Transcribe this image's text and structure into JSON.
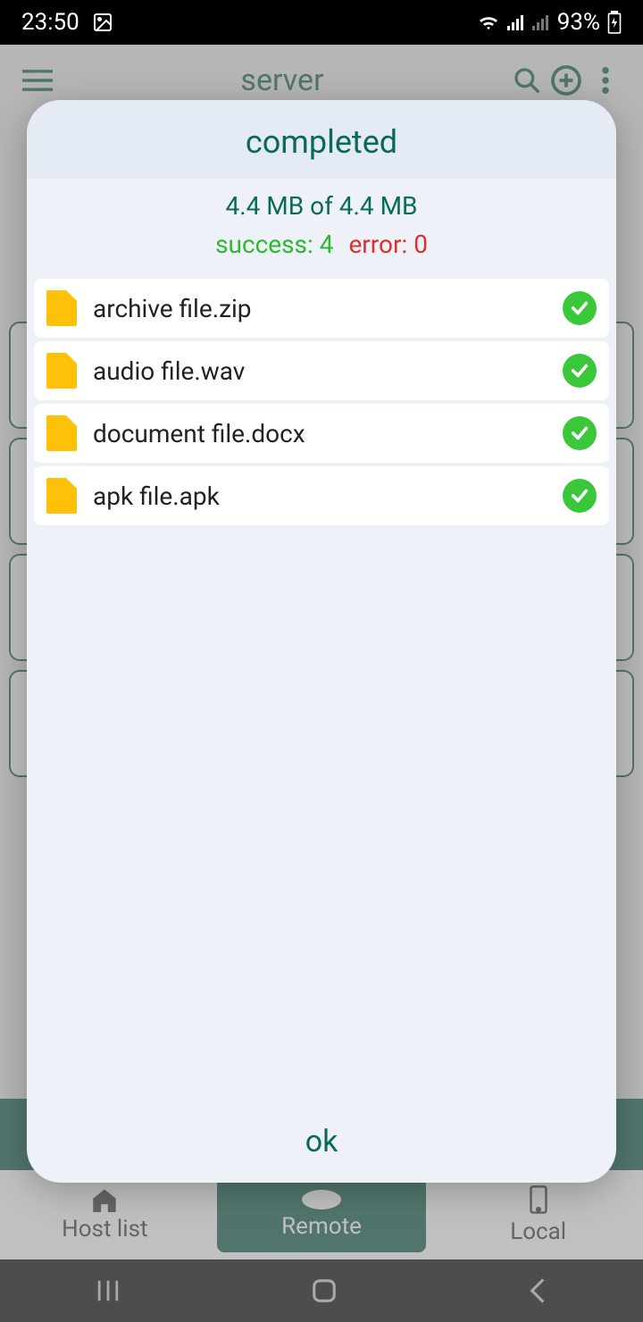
{
  "status_bar": {
    "time": "23:50",
    "battery": "93%"
  },
  "app": {
    "title": "server",
    "nav": {
      "host": "Host list",
      "remote": "Remote",
      "local": "Local"
    }
  },
  "dialog": {
    "title": "completed",
    "transfer": "4.4 MB of 4.4 MB",
    "success_label": "success: ",
    "success_count": "4",
    "error_label": "error: ",
    "error_count": "0",
    "files": [
      {
        "name": "archive file.zip"
      },
      {
        "name": "audio file.wav"
      },
      {
        "name": "document file.docx"
      },
      {
        "name": "apk file.apk"
      }
    ],
    "ok": "ok"
  }
}
